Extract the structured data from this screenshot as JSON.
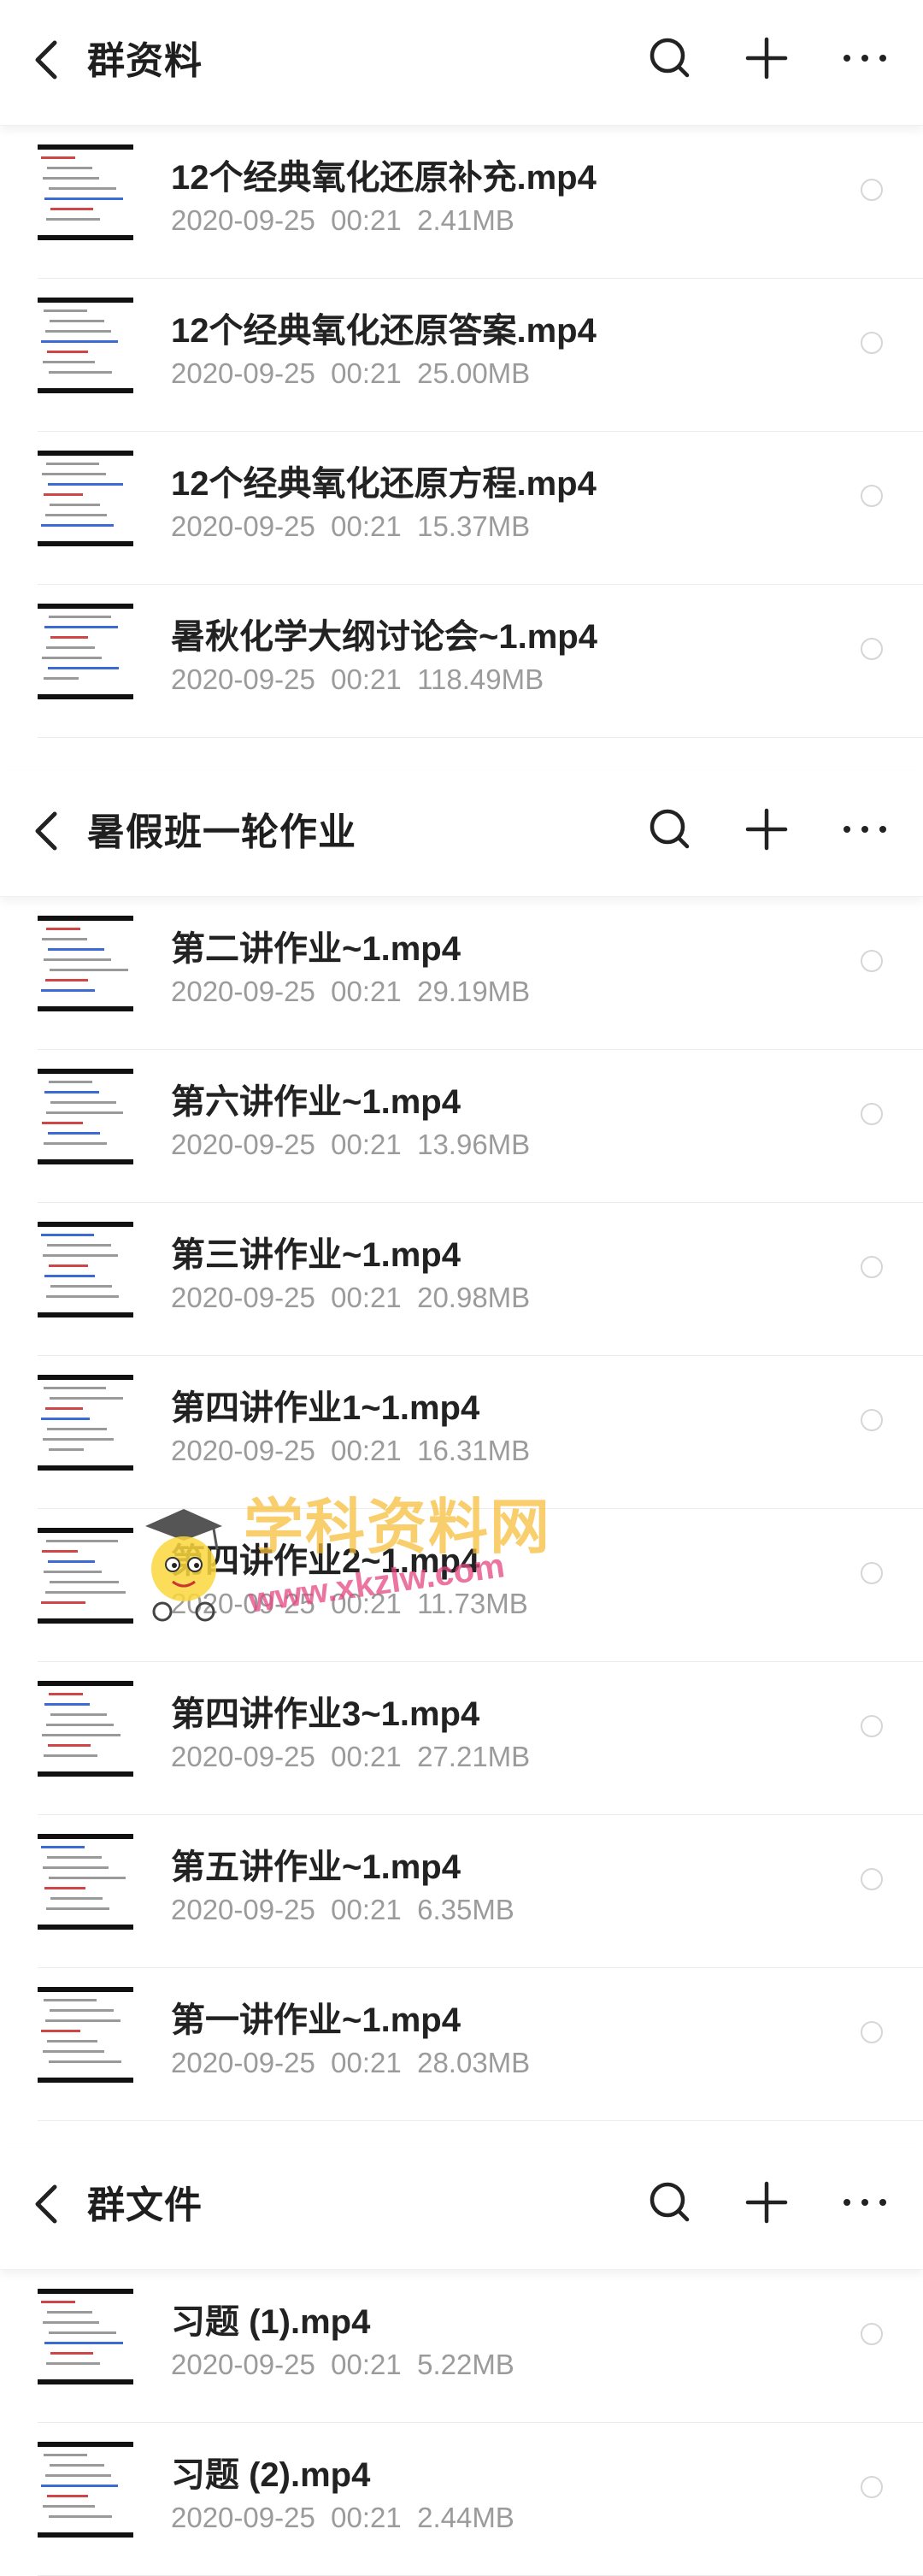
{
  "sections": [
    {
      "title": "群资料",
      "files": [
        {
          "name": "12个经典氧化还原补充.mp4",
          "date": "2020-09-25",
          "time": "00:21",
          "size": "2.41MB"
        },
        {
          "name": "12个经典氧化还原答案.mp4",
          "date": "2020-09-25",
          "time": "00:21",
          "size": "25.00MB"
        },
        {
          "name": "12个经典氧化还原方程.mp4",
          "date": "2020-09-25",
          "time": "00:21",
          "size": "15.37MB"
        },
        {
          "name": "暑秋化学大纲讨论会~1.mp4",
          "date": "2020-09-25",
          "time": "00:21",
          "size": "118.49MB"
        }
      ]
    },
    {
      "title": "暑假班一轮作业",
      "files": [
        {
          "name": "第二讲作业~1.mp4",
          "date": "2020-09-25",
          "time": "00:21",
          "size": "29.19MB"
        },
        {
          "name": "第六讲作业~1.mp4",
          "date": "2020-09-25",
          "time": "00:21",
          "size": "13.96MB"
        },
        {
          "name": "第三讲作业~1.mp4",
          "date": "2020-09-25",
          "time": "00:21",
          "size": "20.98MB"
        },
        {
          "name": "第四讲作业1~1.mp4",
          "date": "2020-09-25",
          "time": "00:21",
          "size": "16.31MB"
        },
        {
          "name": "第四讲作业2~1.mp4",
          "date": "2020-09-25",
          "time": "00:21",
          "size": "11.73MB"
        },
        {
          "name": "第四讲作业3~1.mp4",
          "date": "2020-09-25",
          "time": "00:21",
          "size": "27.21MB"
        },
        {
          "name": "第五讲作业~1.mp4",
          "date": "2020-09-25",
          "time": "00:21",
          "size": "6.35MB"
        },
        {
          "name": "第一讲作业~1.mp4",
          "date": "2020-09-25",
          "time": "00:21",
          "size": "28.03MB"
        }
      ]
    },
    {
      "title": "群文件",
      "files": [
        {
          "name": "习题 (1).mp4",
          "date": "2020-09-25",
          "time": "00:21",
          "size": "5.22MB"
        },
        {
          "name": "习题 (2).mp4",
          "date": "2020-09-25",
          "time": "00:21",
          "size": "2.44MB"
        }
      ]
    }
  ],
  "icons": {
    "back": "back-chevron-icon",
    "search": "search-icon",
    "add": "plus-icon",
    "more": "more-dots-icon",
    "select": "radio-circle-icon"
  },
  "watermark": {
    "text": "学科资料网",
    "url": "www.xkzlw.com"
  },
  "colors": {
    "title": "#1f1f1f",
    "filename": "#222222",
    "meta": "#9b9b9b",
    "radio": "#d6d6d6"
  }
}
